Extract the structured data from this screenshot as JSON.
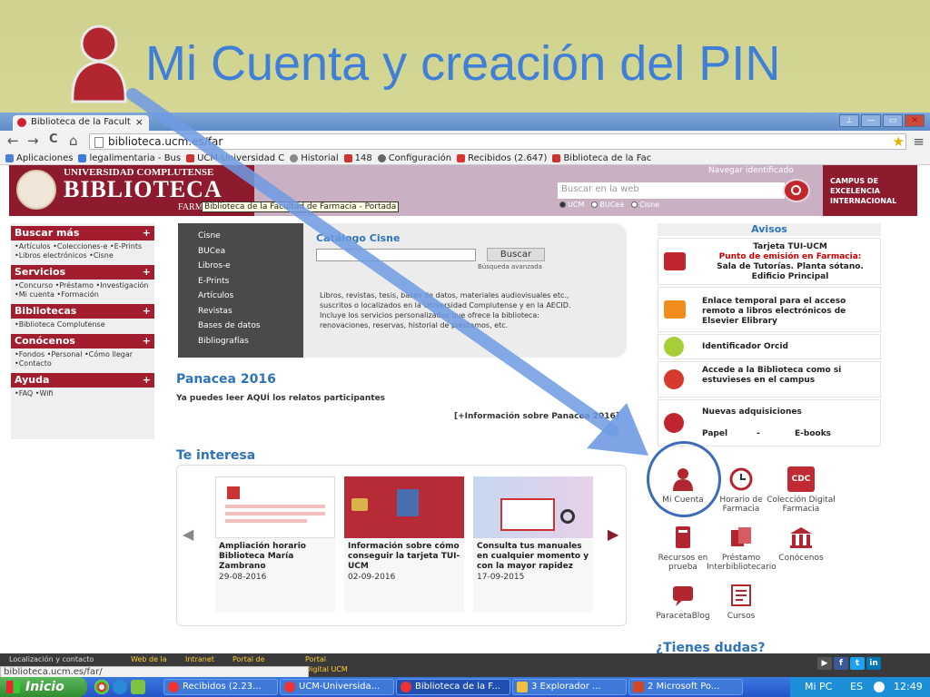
{
  "slide": {
    "title": "Mi Cuenta y creación del PIN"
  },
  "browser": {
    "tab_title": "Biblioteca de la Facult",
    "tab_close": "×",
    "url": "biblioteca.ucm.es/far",
    "nav": {
      "back": "←",
      "forward": "→",
      "reload": "C",
      "home": "⌂",
      "star": "★",
      "menu": "≡"
    },
    "window_buttons": [
      "⊥",
      "—",
      "▭",
      "✕"
    ],
    "bookmarks": [
      "Aplicaciones",
      "legalimentaria - Bus",
      "UCM-Universidad C",
      "Historial",
      "148",
      "Configuración",
      "Recibidos (2.647)",
      "Biblioteca de la Fac"
    ],
    "status_url": "biblioteca.ucm.es/far/"
  },
  "site": {
    "university": "UNIVERSIDAD COMPLUTENSE",
    "library": "BIBLIOTECA",
    "faculty": "FARMACIA",
    "tooltip": "Biblioteca de la Facultad de Farmacia - Portada",
    "nav_ident": "Navegar identificado",
    "search_placeholder": "Buscar en la web",
    "radios": [
      "UCM",
      "BUCea",
      "Cisne"
    ],
    "campus": [
      "CAMPUS DE",
      "EXCELENCIA",
      "INTERNACIONAL"
    ],
    "left_menu": [
      {
        "title": "Buscar más",
        "body": "•Artículos •Colecciones-e •E-Prints •Libros electrónicos •Cisne"
      },
      {
        "title": "Servicios",
        "body": "•Concurso •Préstamo •Investigación •Mi cuenta •Formación"
      },
      {
        "title": "Bibliotecas",
        "body": "•Biblioteca Complutense"
      },
      {
        "title": "Conócenos",
        "body": "•Fondos •Personal •Cómo llegar •Contacto"
      },
      {
        "title": "Ayuda",
        "body": "•FAQ •Wifi"
      }
    ],
    "plus": "+",
    "catalog_nav": [
      "Cisne",
      "BUCea",
      "Libros-e",
      "E-Prints",
      "Artículos",
      "Revistas",
      "Bases de datos",
      "Bibliografías"
    ],
    "catalog_title": "Catálogo Cisne",
    "catalog_button": "Buscar",
    "catalog_adv": "Búsqueda avanzada",
    "catalog_desc": "Libros, revistas, tesis, bases de datos, materiales audiovisuales etc., suscritos o localizados en la Universidad Complutense y en la AECID. Incluye los servicios personalizados que ofrece la biblioteca: renovaciones, reservas, historial de préstamos, etc.",
    "panacea_title": "Panacea 2016",
    "panacea_text": "Ya puedes leer AQUÍ los relatos participantes",
    "panacea_more": "[+Información sobre Panacea 2016]",
    "interesa_title": "Te interesa",
    "arrow_left": "◀",
    "arrow_right": "▶",
    "cards": [
      {
        "title": "Ampliación horario Biblioteca María Zambrano",
        "date": "29-08-2016"
      },
      {
        "title": "Información sobre cómo conseguir la tarjeta TUI-UCM",
        "date": "02-09-2016"
      },
      {
        "title": "Consulta tus manuales en cualquier momento y con la mayor rapidez",
        "date": "17-09-2015"
      }
    ],
    "avisos_title": "Avisos",
    "avisos": [
      {
        "line1": "Tarjeta TUI-UCM",
        "line2": "Punto de emisión en Farmacia:",
        "line3": "Sala de Tutorías. Planta sótano. Edificio Principal"
      },
      {
        "text": "Enlace temporal para el acceso remoto a libros electrónicos de Elsevier Elibrary"
      },
      {
        "text": "Identificador Orcid"
      },
      {
        "text": "Accede a la Biblioteca como si estuvieses en el campus"
      },
      {
        "line1": "Nuevas adquisiciones",
        "line2": "Papel",
        "line3": "-",
        "line4": "E-books"
      }
    ],
    "icons": [
      {
        "label": "Mi Cuenta",
        "icon": "user-icon"
      },
      {
        "label": "Horario de Farmacia",
        "icon": "clock-icon"
      },
      {
        "label": "Colección Digital Farmacia",
        "icon": "cdc-icon"
      },
      {
        "label": "Recursos en prueba",
        "icon": "trial-icon"
      },
      {
        "label": "Préstamo Interbibliotecario",
        "icon": "loan-icon"
      },
      {
        "label": "Conócenos",
        "icon": "building-icon"
      },
      {
        "label": "ParacetaBlog",
        "icon": "blog-icon"
      },
      {
        "label": "Cursos",
        "icon": "courses-icon"
      }
    ],
    "cdc_text": "CDC",
    "tienes_dudas": "¿Tienes dudas?",
    "footer": {
      "contact": "Localización y contacto",
      "links": [
        "Web de la",
        "Intranet",
        "Portal de",
        "Portal",
        "Digital UCM"
      ]
    }
  },
  "taskbar": {
    "start": "Inicio",
    "items": [
      "Recibidos (2.23...",
      "UCM-Universida...",
      "Biblioteca de la F...",
      "3 Explorador ...",
      "2 Microsoft Po..."
    ],
    "computer": "Mi PC",
    "lang": "ES",
    "time": "12:49"
  },
  "colors": {
    "accent": "#3f7fd7",
    "brand": "#8d1b2d",
    "menu_red": "#a21e2e",
    "arrow": "#6f9be3"
  }
}
